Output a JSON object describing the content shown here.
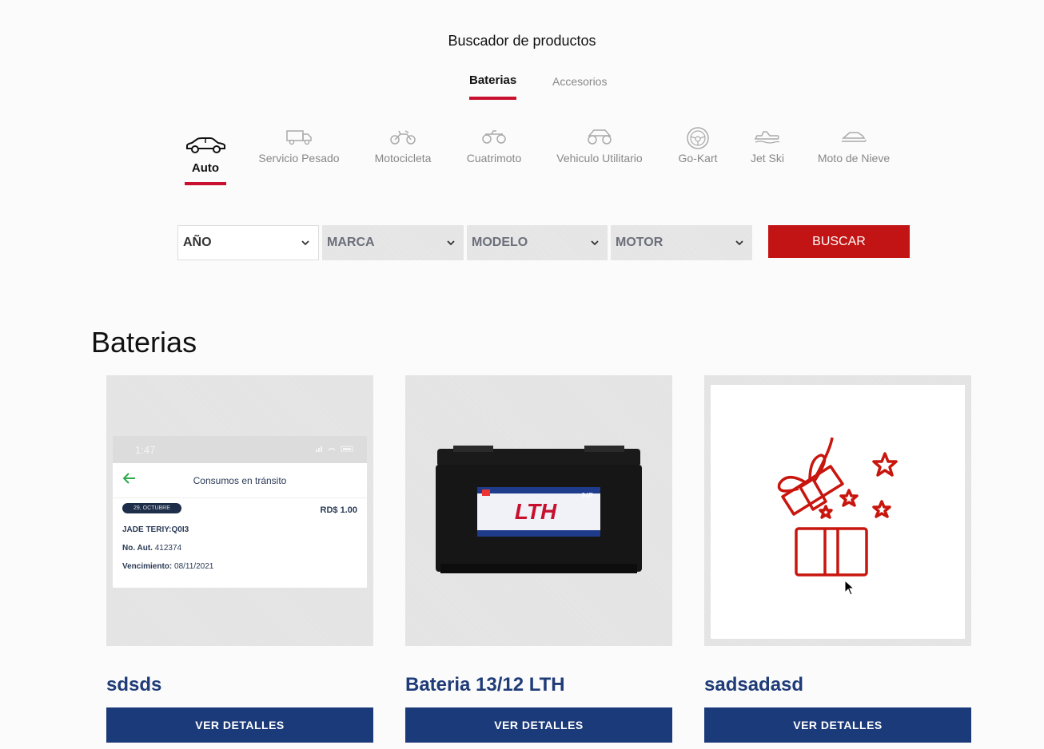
{
  "finder": {
    "title": "Buscador de productos",
    "tabs": [
      {
        "label": "Baterias",
        "active": true
      },
      {
        "label": "Accesorios",
        "active": false
      }
    ]
  },
  "vehicle_types": [
    {
      "label": "Auto",
      "icon": "car-icon",
      "active": true
    },
    {
      "label": "Servicio Pesado",
      "icon": "truck-icon",
      "active": false
    },
    {
      "label": "Motocicleta",
      "icon": "motorcycle-icon",
      "active": false
    },
    {
      "label": "Cuatrimoto",
      "icon": "atv-icon",
      "active": false
    },
    {
      "label": "Vehiculo Utilitario",
      "icon": "utility-vehicle-icon",
      "active": false
    },
    {
      "label": "Go-Kart",
      "icon": "steering-wheel-icon",
      "active": false
    },
    {
      "label": "Jet Ski",
      "icon": "jet-ski-icon",
      "active": false
    },
    {
      "label": "Moto de Nieve",
      "icon": "snowmobile-icon",
      "active": false
    }
  ],
  "filters": {
    "year": "AÑO",
    "brand": "MARCA",
    "model": "MODELO",
    "engine": "MOTOR",
    "search_label": "BUSCAR"
  },
  "section": {
    "title": "Baterias"
  },
  "products": [
    {
      "name": "sdsds",
      "button": "VER DETALLES",
      "image": {
        "time": "1:47",
        "header": "Consumos en tránsito",
        "date": "29, OCTUBRE",
        "amount": "RD$ 1.00",
        "line1": "JADE TERIY:Q0I3",
        "line2_label": "No. Aut.",
        "line2_value": "412374",
        "line3_label": "Vencimiento:",
        "line3_value": "08/11/2021"
      }
    },
    {
      "name": "Bateria 13/12 LTH",
      "button": "VER DETALLES",
      "image": {
        "brand": "LTH",
        "code": "94R"
      }
    },
    {
      "name": "sadsadasd",
      "button": "VER DETALLES",
      "image": {
        "icon": "gift-box-icon"
      }
    }
  ],
  "colors": {
    "accent_red": "#c8102e",
    "button_red": "#c21414",
    "navy": "#1b3a7a",
    "title_blue": "#1f3c78"
  }
}
